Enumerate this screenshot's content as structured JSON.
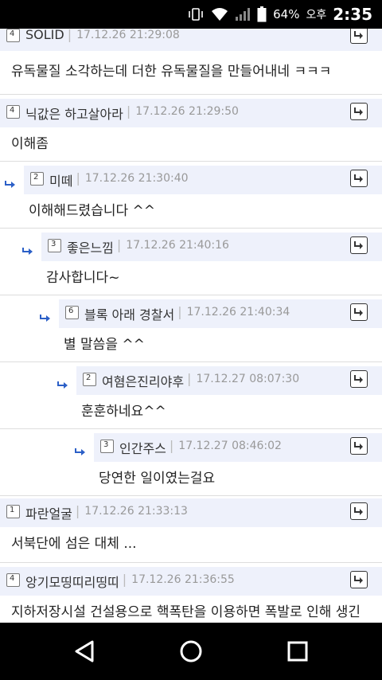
{
  "status": {
    "battery": "64%",
    "ampm": "오후",
    "time": "2:35"
  },
  "comments": [
    {
      "level": "4",
      "nick": "SOLID",
      "time": "17.12.26 21:29:08",
      "body": "유독물질 소각하는데 더한 유독물질을 만들어내네 ㅋㅋㅋ",
      "depth": 0
    },
    {
      "level": "4",
      "nick": "닉값은 하고살아라",
      "time": "17.12.26 21:29:50",
      "body": "이해좀",
      "depth": 0
    },
    {
      "level": "2",
      "nick": "미떼",
      "time": "17.12.26 21:30:40",
      "body": "이해해드렸습니다 ^^",
      "depth": 1
    },
    {
      "level": "3",
      "nick": "좋은느낌",
      "time": "17.12.26 21:40:16",
      "body": "감사합니다~",
      "depth": 2
    },
    {
      "level": "6",
      "nick": "블록 아래 경찰서",
      "time": "17.12.26 21:40:34",
      "body": "별 말씀을 ^^",
      "depth": 3
    },
    {
      "level": "2",
      "nick": "여혐은진리야후",
      "time": "17.12.27 08:07:30",
      "body": "훈훈하네요^^",
      "depth": 4
    },
    {
      "level": "3",
      "nick": "인간주스",
      "time": "17.12.27 08:46:02",
      "body": "당연한 일이였는걸요",
      "depth": 5
    },
    {
      "level": "1",
      "nick": "파란얼굴",
      "time": "17.12.26 21:33:13",
      "body": "서북단에 섬은 대체 ...",
      "depth": 0
    },
    {
      "level": "4",
      "nick": "앙기모띵띠리띵띠",
      "time": "17.12.26 21:36:55",
      "body": "지하저장시설 건설용으로 핵폭탄을 이용하면 폭발로 인해 생긴",
      "depth": 0
    }
  ]
}
